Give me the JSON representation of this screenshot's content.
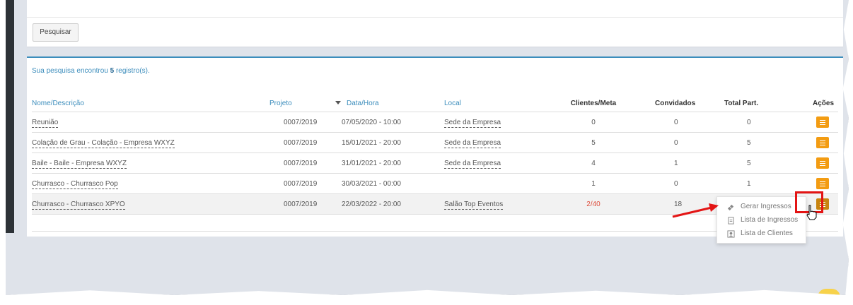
{
  "search": {
    "button_label": "Pesquisar"
  },
  "results": {
    "summary_prefix": "Sua pesquisa encontrou ",
    "summary_count": "5",
    "summary_suffix": " registro(s)."
  },
  "table": {
    "headers": {
      "nome": "Nome/Descrição",
      "projeto": "Projeto",
      "data": "Data/Hora",
      "local": "Local",
      "clientes": "Clientes/Meta",
      "convidados": "Convidados",
      "total": "Total Part.",
      "acoes": "Ações"
    },
    "rows": [
      {
        "nome": "Reunião",
        "projeto": "0007/2019",
        "data": "07/05/2020 - 10:00",
        "local": "Sede da Empresa",
        "clientes": "0",
        "convidados": "0",
        "total": "0"
      },
      {
        "nome": "Colação de Grau - Colação - Empresa WXYZ",
        "projeto": "0007/2019",
        "data": "15/01/2021 - 20:00",
        "local": "Sede da Empresa",
        "clientes": "5",
        "convidados": "0",
        "total": "5"
      },
      {
        "nome": "Baile - Baile - Empresa WXYZ",
        "projeto": "0007/2019",
        "data": "31/01/2021 - 20:00",
        "local": "Sede da Empresa",
        "clientes": "4",
        "convidados": "1",
        "total": "5"
      },
      {
        "nome": "Churrasco - Churrasco Pop",
        "projeto": "0007/2019",
        "data": "30/03/2021 - 00:00",
        "local": "",
        "clientes": "1",
        "convidados": "0",
        "total": "1"
      },
      {
        "nome": "Churrasco - Churrasco XPYO",
        "projeto": "0007/2019",
        "data": "22/03/2022 - 20:00",
        "local": "Salão Top Eventos",
        "clientes": "2/40",
        "convidados": "18",
        "total": ""
      }
    ]
  },
  "menu": {
    "gerar": "Gerar Ingressos",
    "lista_ingressos": "Lista de Ingressos",
    "lista_clientes": "Lista de Clientes"
  },
  "colors": {
    "accent": "#3c8dbc",
    "action": "#f39c12",
    "highlight": "#e31414"
  }
}
